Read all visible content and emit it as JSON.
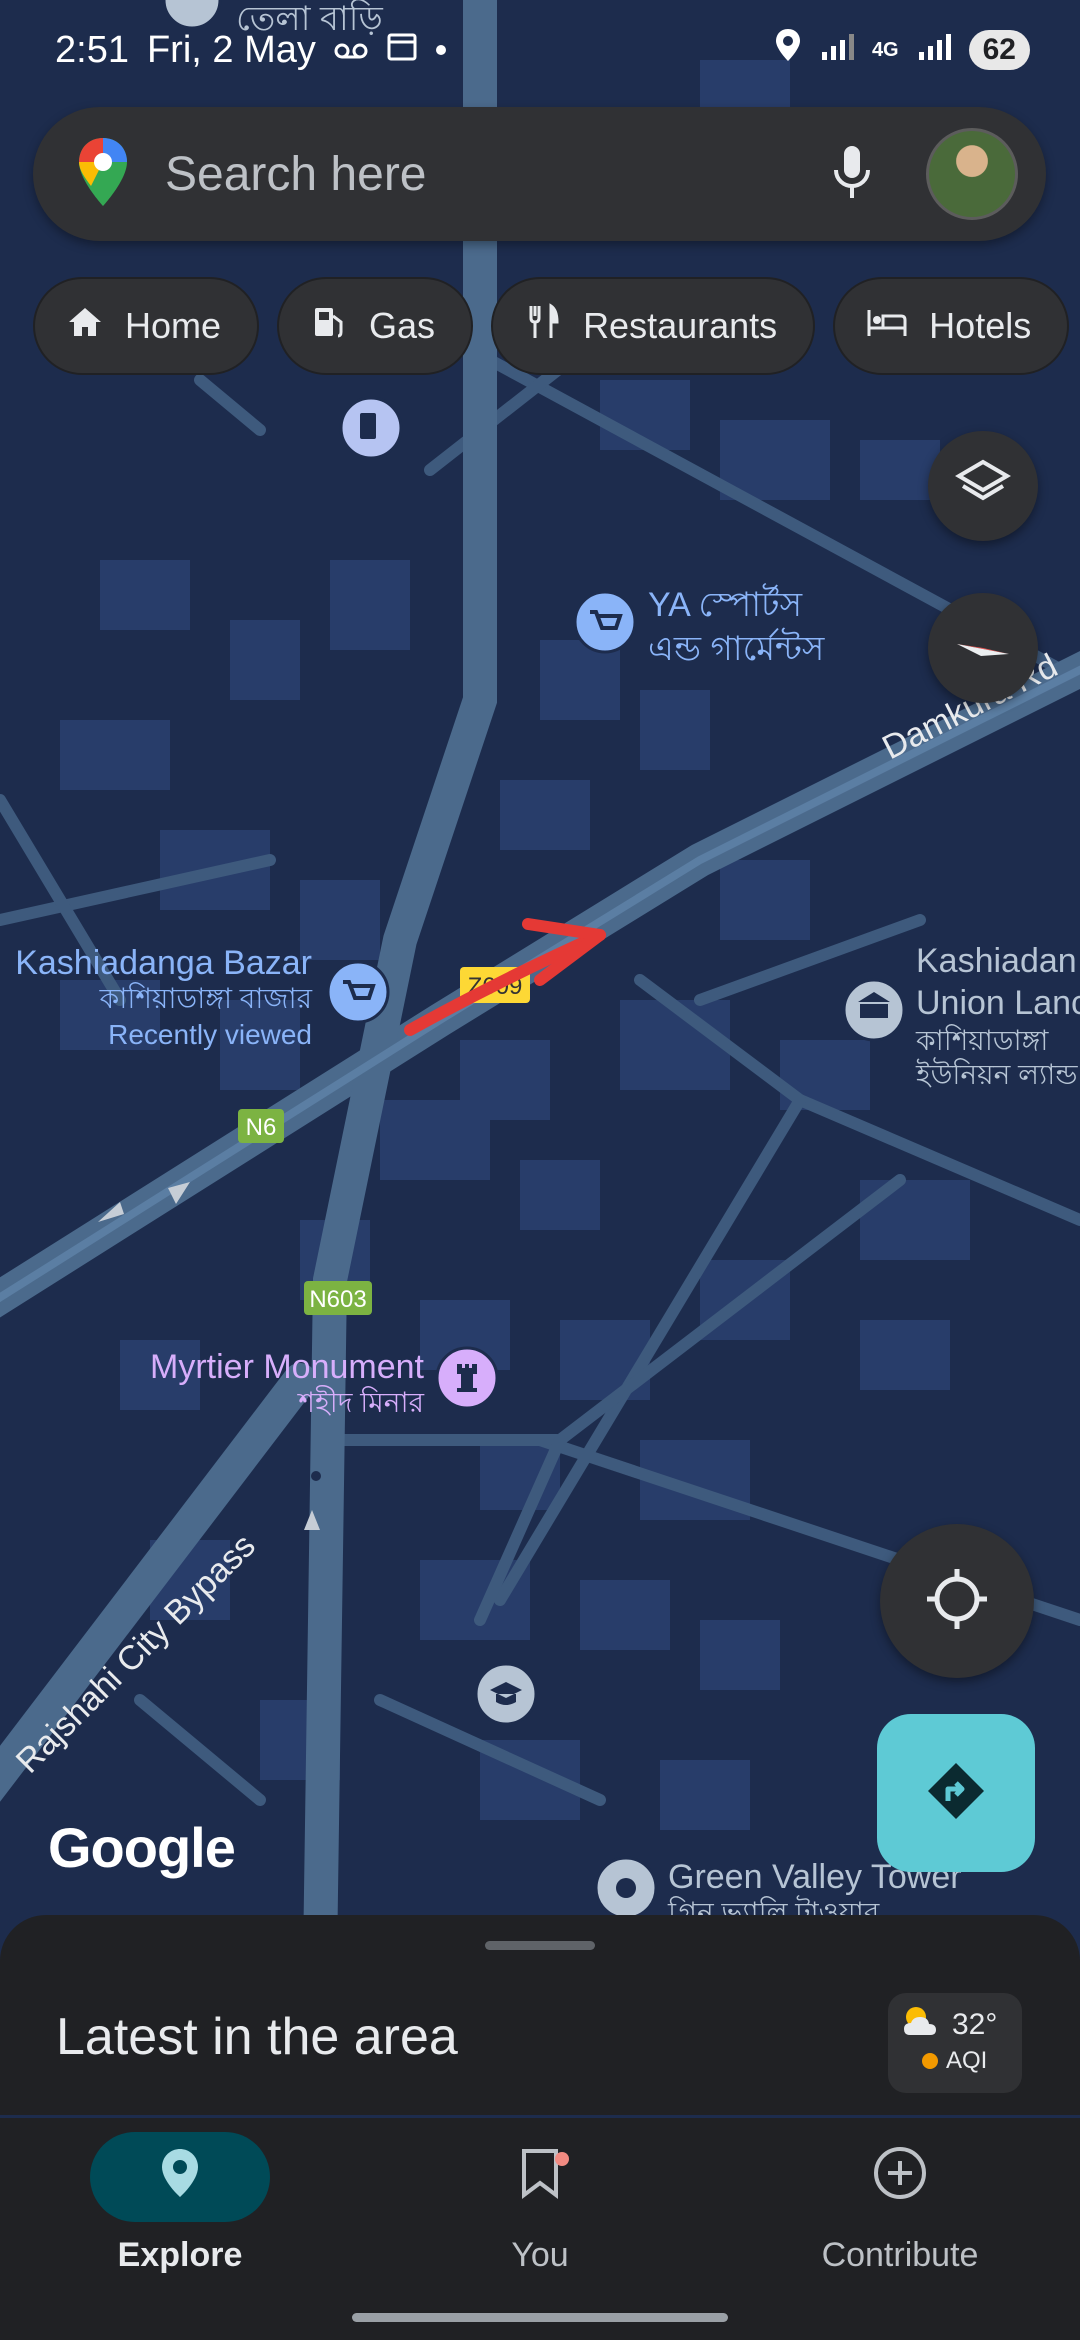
{
  "status_bar": {
    "time": "2:51",
    "date": "Fri, 2 May",
    "network": "4G",
    "battery": "62",
    "icons": [
      "voicemail-icon",
      "calendar-icon",
      "location-icon",
      "signal-icon",
      "battery-icon"
    ]
  },
  "search": {
    "placeholder": "Search here",
    "icons": [
      "maps-pin-logo",
      "mic-icon",
      "avatar"
    ]
  },
  "chips": [
    {
      "label": "Home",
      "icon": "home-icon"
    },
    {
      "label": "Gas",
      "icon": "gas-station-icon"
    },
    {
      "label": "Restaurants",
      "icon": "fork-knife-icon"
    },
    {
      "label": "Hotels",
      "icon": "bed-icon"
    }
  ],
  "map": {
    "places": {
      "ya_sports_en": "YA স্পোর্টস",
      "ya_sports_bn": "এন্ড গার্মেন্টস",
      "bazar_en": "Kashiadanga Bazar",
      "bazar_bn": "কাশিয়াডাঙ্গা বাজার",
      "bazar_note": "Recently viewed",
      "union_en1": "Kashiadan",
      "union_en2": "Union Lanc",
      "union_bn1": "কাশিয়াডাঙ্গা",
      "union_bn2": "ইউনিয়ন ল্যান্ড স",
      "monument_en": "Myrtier Monument",
      "monument_bn": "শহীদ মিনার",
      "green_valley_en": "Green Valley Tower",
      "green_valley_bn": "গ্রিন ভ্যালি টাওয়ার",
      "top_label": "তেলা বাড়ি"
    },
    "roads": {
      "damkura": "Damkura Rd",
      "bypass": "Rajshahi City Bypass",
      "n6": "N6",
      "n603": "N603",
      "z609": "Z609"
    },
    "attribution": "Google",
    "colors": {
      "background": "#1d2c4d",
      "road": "#4b6a8c",
      "building": "#283d6a",
      "annotation": "#e53935"
    }
  },
  "controls": {
    "icons": [
      "layers-icon",
      "compass-icon",
      "my-location-icon",
      "directions-icon"
    ]
  },
  "sheet": {
    "title": "Latest in the area",
    "weather": {
      "temp": "32°",
      "aqi": "AQI"
    }
  },
  "bottom_nav": [
    {
      "label": "Explore",
      "icon": "explore-pin-icon",
      "active": true
    },
    {
      "label": "You",
      "icon": "bookmark-icon",
      "active": false
    },
    {
      "label": "Contribute",
      "icon": "add-circle-icon",
      "active": false
    }
  ]
}
